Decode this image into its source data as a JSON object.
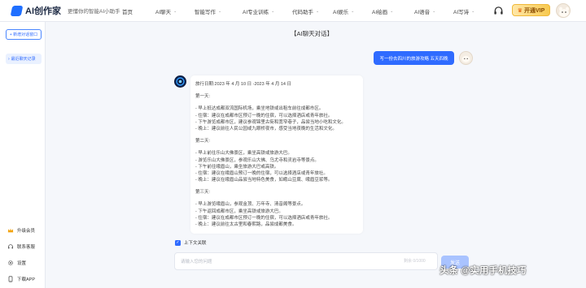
{
  "brand": {
    "name": "AI创作家",
    "slogan": "更懂你的智能AI小助手"
  },
  "nav": [
    {
      "label": "首页",
      "has_dropdown": false
    },
    {
      "label": "AI聊天",
      "has_dropdown": true
    },
    {
      "label": "智能写作",
      "has_dropdown": true
    },
    {
      "label": "AI专业训练",
      "has_dropdown": true
    },
    {
      "label": "代码助手",
      "has_dropdown": true
    },
    {
      "label": "AI娱乐",
      "has_dropdown": true
    },
    {
      "label": "AI绘画",
      "has_dropdown": true
    },
    {
      "label": "AI语音",
      "has_dropdown": true
    },
    {
      "label": "AI写诗",
      "has_dropdown": true
    }
  ],
  "header": {
    "vip_label": "开通VIP"
  },
  "sidebar": {
    "new_chat": "+ 新增对话窗口",
    "history": "最近聊天记录",
    "menu": [
      {
        "label": "升级会员",
        "icon": "crown-icon"
      },
      {
        "label": "联系客服",
        "icon": "headset-icon"
      },
      {
        "label": "设置",
        "icon": "gear-icon"
      },
      {
        "label": "下载APP",
        "icon": "phone-icon"
      }
    ]
  },
  "chat": {
    "title": "【AI聊天对话】",
    "user_message": "写一份去四川的旅游攻略 五天四晚",
    "reply_lines": [
      "旅行日期:2023 年 4 月 10 日 -2023 年 4 月 14 日",
      "",
      "第一天:",
      "",
      "- 早上抵达成都双流国际机场，乘坐地铁或出租车前往成都市区。",
      "- 住宿：建议在成都市区预订一晚的住宿，可以选择酒店或青年旅社。",
      "- 下午游览成都市区，建议参观锦里古街和宽窄巷子，品尝当地小吃和文化。",
      "- 晚上：建议前往人民公园或九眼桥夜市，感受当地夜晚的生活和文化。",
      "",
      "第二天:",
      "",
      "- 早上前往乐山大佛景区，乘坐高铁或旅游大巴。",
      "- 游览乐山大佛景区，参观乐山大佛、乌尤寺和灵岩寺等景点。",
      "- 下午前往峨眉山，乘坐旅游大巴或高铁。",
      "- 住宿：建议在峨眉山预订一晚的住宿，可以选择酒店或青年旅社。",
      "- 晚上：建议在峨眉山品尝当地特色美食，如峨山豆腐、峨眉豆浆等。",
      "",
      "第三天:",
      "",
      "- 早上游览峨眉山，参观金顶、万年寺、清音阁等景点。",
      "- 下午返回成都市区，乘坐高铁或旅游大巴。",
      "- 住宿：建议在成都市区预订一晚的住宿，可以选择酒店或青年旅社。",
      "- 晚上：建议前往太古里和春熙路，品尝成都美食。"
    ],
    "context_label": "上下文关联",
    "context_checked": true,
    "input_placeholder": "请输入您的问题",
    "counter": "剩余 0/1000",
    "send_label": "发送"
  },
  "watermark": "头条 @实用手机技巧",
  "colors": {
    "accent": "#2f6bff",
    "vip": "#f7c94f"
  }
}
